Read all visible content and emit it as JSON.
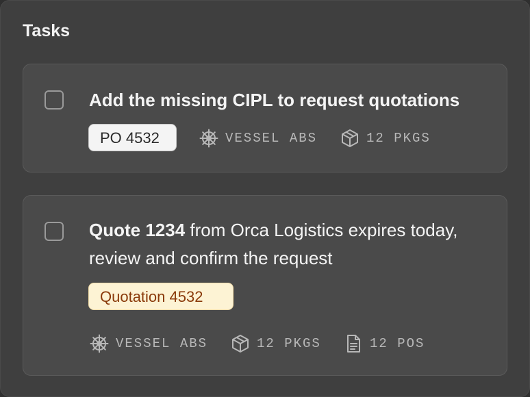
{
  "panel": {
    "title": "Tasks"
  },
  "tasks": [
    {
      "title": "Add the missing CIPL to request quotations",
      "tag": "PO 4532",
      "vessel": "VESSEL ABS",
      "pkgs": "12 PKGS"
    },
    {
      "title_strong": "Quote 1234",
      "title_rest": " from Orca Logistics expires today, review and confirm the request",
      "tag": "Quotation 4532",
      "vessel": "VESSEL ABS",
      "pkgs": "12 PKGS",
      "pos": "12 POS"
    }
  ],
  "icons": {
    "vessel": "ship-wheel-icon",
    "pkgs": "package-icon",
    "pos": "document-icon"
  },
  "colors": {
    "panel_bg": "#3f3f3f",
    "card_bg": "#4a4a4a",
    "quote_tag_bg": "#fdf3d4",
    "quote_tag_text": "#8a3a0a"
  }
}
